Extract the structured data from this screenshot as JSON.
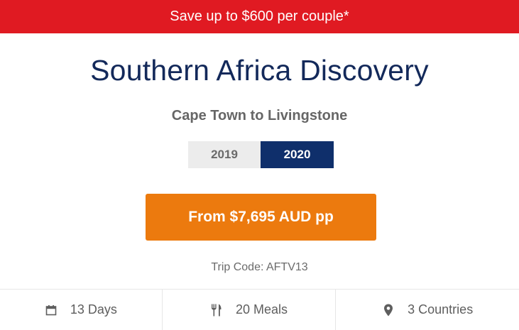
{
  "promo": {
    "text": "Save up to $600 per couple*"
  },
  "trip": {
    "title": "Southern Africa Discovery",
    "route": "Cape Town to Livingstone",
    "trip_code": "Trip Code: AFTV13"
  },
  "year_tabs": [
    {
      "label": "2019",
      "selected": false
    },
    {
      "label": "2020",
      "selected": true
    }
  ],
  "price_button": {
    "label": "From $7,695 AUD pp"
  },
  "stats": [
    {
      "icon": "calendar-icon",
      "label": "13 Days"
    },
    {
      "icon": "utensils-icon",
      "label": "20 Meals"
    },
    {
      "icon": "location-pin-icon",
      "label": "3 Countries"
    }
  ],
  "colors": {
    "promo_bg": "#e01a22",
    "title": "#13295a",
    "active_tab": "#0f2f6b",
    "price_button": "#ec7a0e"
  }
}
